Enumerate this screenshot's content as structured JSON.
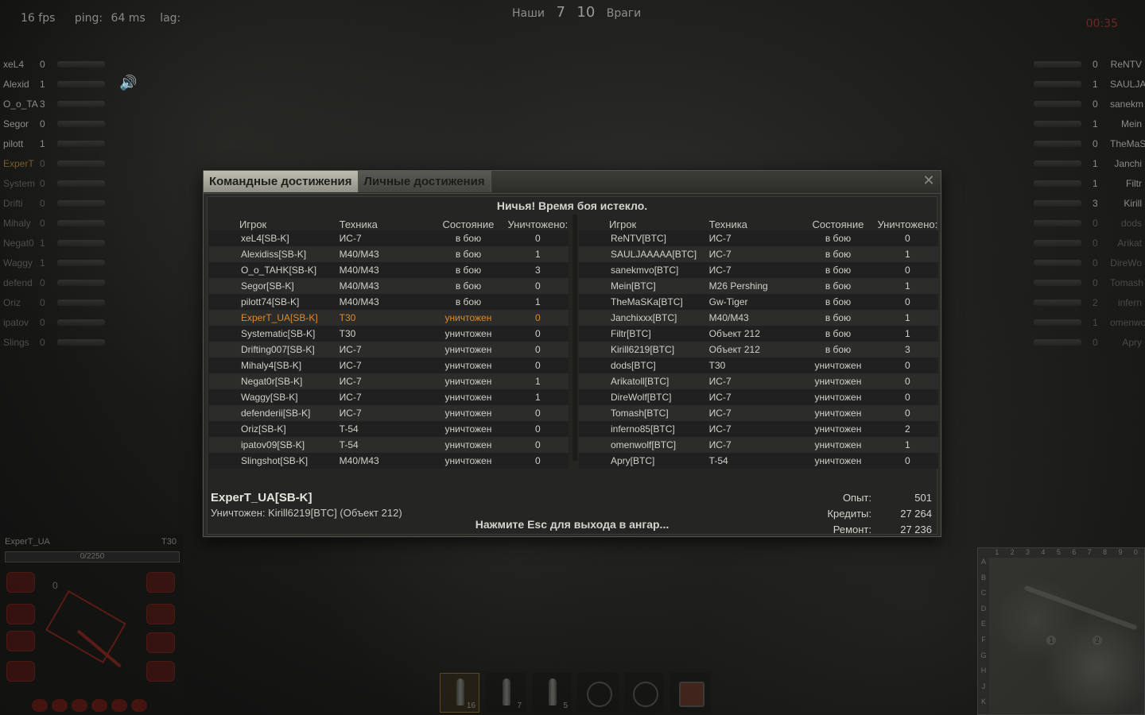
{
  "hud": {
    "fps": "16 fps",
    "ping_label": "ping:",
    "ping_value": "64 ms",
    "lag_label": "lag:",
    "score_allies_label": "Наши",
    "score_allies": "7",
    "score_enemies": "10",
    "score_enemies_label": "Враги",
    "timer": "00:35"
  },
  "left_list": [
    {
      "name": "xeL4",
      "frags": "0",
      "dead": false,
      "self": false
    },
    {
      "name": "Alexid",
      "frags": "1",
      "dead": false,
      "self": false
    },
    {
      "name": "O_o_TA",
      "frags": "3",
      "dead": false,
      "self": false
    },
    {
      "name": "Segor",
      "frags": "0",
      "dead": false,
      "self": false
    },
    {
      "name": "pilott",
      "frags": "1",
      "dead": false,
      "self": false
    },
    {
      "name": "ExperT",
      "frags": "0",
      "dead": true,
      "self": true
    },
    {
      "name": "System",
      "frags": "0",
      "dead": true,
      "self": false
    },
    {
      "name": "Drifti",
      "frags": "0",
      "dead": true,
      "self": false
    },
    {
      "name": "Mihaly",
      "frags": "0",
      "dead": true,
      "self": false
    },
    {
      "name": "Negat0",
      "frags": "1",
      "dead": true,
      "self": false
    },
    {
      "name": "Waggy",
      "frags": "1",
      "dead": true,
      "self": false
    },
    {
      "name": "defend",
      "frags": "0",
      "dead": true,
      "self": false
    },
    {
      "name": "Oriz",
      "frags": "0",
      "dead": true,
      "self": false
    },
    {
      "name": "ipatov",
      "frags": "0",
      "dead": true,
      "self": false
    },
    {
      "name": "Slings",
      "frags": "0",
      "dead": true,
      "self": false
    }
  ],
  "right_list": [
    {
      "name": "ReNTV",
      "frags": "0",
      "dead": false
    },
    {
      "name": "SAULJA",
      "frags": "1",
      "dead": false
    },
    {
      "name": "sanekm",
      "frags": "0",
      "dead": false
    },
    {
      "name": "Mein",
      "frags": "1",
      "dead": false
    },
    {
      "name": "TheMaS",
      "frags": "0",
      "dead": false
    },
    {
      "name": "Janchi",
      "frags": "1",
      "dead": false
    },
    {
      "name": "Filtr",
      "frags": "1",
      "dead": false
    },
    {
      "name": "Kirill",
      "frags": "3",
      "dead": false
    },
    {
      "name": "dods",
      "frags": "0",
      "dead": true
    },
    {
      "name": "Arikat",
      "frags": "0",
      "dead": true
    },
    {
      "name": "DireWo",
      "frags": "0",
      "dead": true
    },
    {
      "name": "Tomash",
      "frags": "0",
      "dead": true
    },
    {
      "name": "infern",
      "frags": "2",
      "dead": true
    },
    {
      "name": "omenwo",
      "frags": "1",
      "dead": true
    },
    {
      "name": "Apry",
      "frags": "0",
      "dead": true
    }
  ],
  "dialog": {
    "tab_team": "Командные достижения",
    "tab_personal": "Личные достижения",
    "close": "✕",
    "result": "Ничья! Время боя истекло.",
    "headers": {
      "player": "Игрок",
      "vehicle": "Техника",
      "state": "Состояние",
      "kills": "Уничтожено:"
    },
    "allies": [
      {
        "name": "xeL4[SB-K]",
        "vehicle": "ИС-7",
        "state": "в бою",
        "kills": "0"
      },
      {
        "name": "Alexidiss[SB-K]",
        "vehicle": "M40/M43",
        "state": "в бою",
        "kills": "1"
      },
      {
        "name": "O_o_TAHK[SB-K]",
        "vehicle": "M40/M43",
        "state": "в бою",
        "kills": "3"
      },
      {
        "name": "Segor[SB-K]",
        "vehicle": "M40/M43",
        "state": "в бою",
        "kills": "0"
      },
      {
        "name": "pilott74[SB-K]",
        "vehicle": "M40/M43",
        "state": "в бою",
        "kills": "1"
      },
      {
        "name": "ExperT_UA[SB-K]",
        "vehicle": "T30",
        "state": "уничтожен",
        "kills": "0",
        "self": true
      },
      {
        "name": "Systematic[SB-K]",
        "vehicle": "T30",
        "state": "уничтожен",
        "kills": "0"
      },
      {
        "name": "Drifting007[SB-K]",
        "vehicle": "ИС-7",
        "state": "уничтожен",
        "kills": "0"
      },
      {
        "name": "Mihaly4[SB-K]",
        "vehicle": "ИС-7",
        "state": "уничтожен",
        "kills": "0"
      },
      {
        "name": "Negat0r[SB-K]",
        "vehicle": "ИС-7",
        "state": "уничтожен",
        "kills": "1"
      },
      {
        "name": "Waggy[SB-K]",
        "vehicle": "ИС-7",
        "state": "уничтожен",
        "kills": "1"
      },
      {
        "name": "defenderii[SB-K]",
        "vehicle": "ИС-7",
        "state": "уничтожен",
        "kills": "0"
      },
      {
        "name": "Oriz[SB-K]",
        "vehicle": "T-54",
        "state": "уничтожен",
        "kills": "0"
      },
      {
        "name": "ipatov09[SB-K]",
        "vehicle": "T-54",
        "state": "уничтожен",
        "kills": "0"
      },
      {
        "name": "Slingshot[SB-K]",
        "vehicle": "M40/M43",
        "state": "уничтожен",
        "kills": "0"
      }
    ],
    "enemies": [
      {
        "name": "ReNTV[BTC]",
        "vehicle": "ИС-7",
        "state": "в бою",
        "kills": "0"
      },
      {
        "name": "SAULJAAAAA[BTC]",
        "vehicle": "ИС-7",
        "state": "в бою",
        "kills": "1"
      },
      {
        "name": "sanekmvo[BTC]",
        "vehicle": "ИС-7",
        "state": "в бою",
        "kills": "0"
      },
      {
        "name": "Mein[BTC]",
        "vehicle": "M26 Pershing",
        "state": "в бою",
        "kills": "1"
      },
      {
        "name": "TheMaSKa[BTC]",
        "vehicle": "Gw-Tiger",
        "state": "в бою",
        "kills": "0"
      },
      {
        "name": "Janchixxx[BTC]",
        "vehicle": "M40/M43",
        "state": "в бою",
        "kills": "1"
      },
      {
        "name": "Filtr[BTC]",
        "vehicle": "Объект 212",
        "state": "в бою",
        "kills": "1"
      },
      {
        "name": "Kirill6219[BTC]",
        "vehicle": "Объект 212",
        "state": "в бою",
        "kills": "3"
      },
      {
        "name": "dods[BTC]",
        "vehicle": "T30",
        "state": "уничтожен",
        "kills": "0"
      },
      {
        "name": "Arikatoll[BTC]",
        "vehicle": "ИС-7",
        "state": "уничтожен",
        "kills": "0"
      },
      {
        "name": "DireWolf[BTC]",
        "vehicle": "ИС-7",
        "state": "уничтожен",
        "kills": "0"
      },
      {
        "name": "Tomash[BTC]",
        "vehicle": "ИС-7",
        "state": "уничтожен",
        "kills": "0"
      },
      {
        "name": "inferno85[BTC]",
        "vehicle": "ИС-7",
        "state": "уничтожен",
        "kills": "2"
      },
      {
        "name": "omenwolf[BTC]",
        "vehicle": "ИС-7",
        "state": "уничтожен",
        "kills": "1"
      },
      {
        "name": "Apry[BTC]",
        "vehicle": "T-54",
        "state": "уничтожен",
        "kills": "0"
      }
    ],
    "player_name": "ExperT_UA[SB-K]",
    "killed_by": "Уничтожен: Kirill6219[BTC] (Объект 212)",
    "esc_hint": "Нажмите Esc для выхода в ангар...",
    "stats": [
      {
        "label": "Опыт:",
        "value": "501"
      },
      {
        "label": "Кредиты:",
        "value": "27 264"
      },
      {
        "label": "Ремонт:",
        "value": "27 236"
      }
    ]
  },
  "tank_panel": {
    "name": "ExperT_UA",
    "type": "T30",
    "hp": "0/2250",
    "speed": "0"
  },
  "ammo": [
    {
      "count": "16",
      "kind": "shell",
      "active": true
    },
    {
      "count": "7",
      "kind": "shell",
      "active": false
    },
    {
      "count": "5",
      "kind": "shell",
      "active": false
    },
    {
      "count": "",
      "kind": "consumable",
      "active": false
    },
    {
      "count": "",
      "kind": "consumable",
      "active": false
    },
    {
      "count": "",
      "kind": "box",
      "active": false
    }
  ],
  "minimap": {
    "cols": [
      "1",
      "2",
      "3",
      "4",
      "5",
      "6",
      "7",
      "8",
      "9",
      "0"
    ],
    "rows": [
      "A",
      "B",
      "C",
      "D",
      "E",
      "F",
      "G",
      "H",
      "J",
      "K"
    ]
  }
}
